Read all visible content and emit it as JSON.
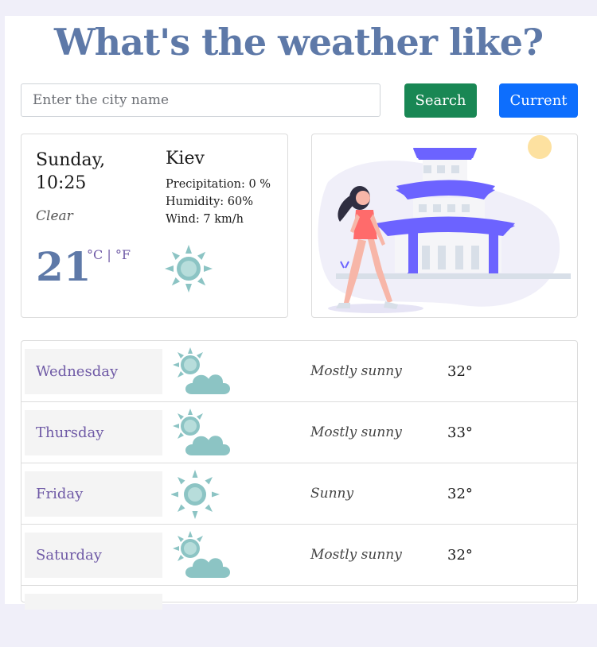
{
  "title": "What's the weather like?",
  "search": {
    "placeholder": "Enter the city name",
    "value": ""
  },
  "buttons": {
    "search": "Search",
    "current": "Current"
  },
  "today": {
    "day": "Sunday,",
    "time": "10:25",
    "description": "Clear",
    "temperature": "21",
    "unit_c": "°C",
    "unit_sep": " | ",
    "unit_f": "°F",
    "city": "Kiev",
    "precipitation": "Precipitation: 0 %",
    "humidity": "Humidity: 60%",
    "wind": "Wind: 7 km/h",
    "icon": "sun-icon"
  },
  "forecast": [
    {
      "day": "Wednesday",
      "description": "Mostly sunny",
      "temp": "32°",
      "icon": "partly-cloudy-icon"
    },
    {
      "day": "Thursday",
      "description": "Mostly sunny",
      "temp": "33°",
      "icon": "partly-cloudy-icon"
    },
    {
      "day": "Friday",
      "description": "Sunny",
      "temp": "32°",
      "icon": "sun-icon"
    },
    {
      "day": "Saturday",
      "description": "Mostly sunny",
      "temp": "32°",
      "icon": "partly-cloudy-icon"
    }
  ],
  "colors": {
    "title": "#5e79a8",
    "search_button": "#198754",
    "current_button": "#0d6efd",
    "accent_purple": "#6f5aa6",
    "icon_teal": "#8cc4c4",
    "pagoda": "#6c63ff"
  }
}
